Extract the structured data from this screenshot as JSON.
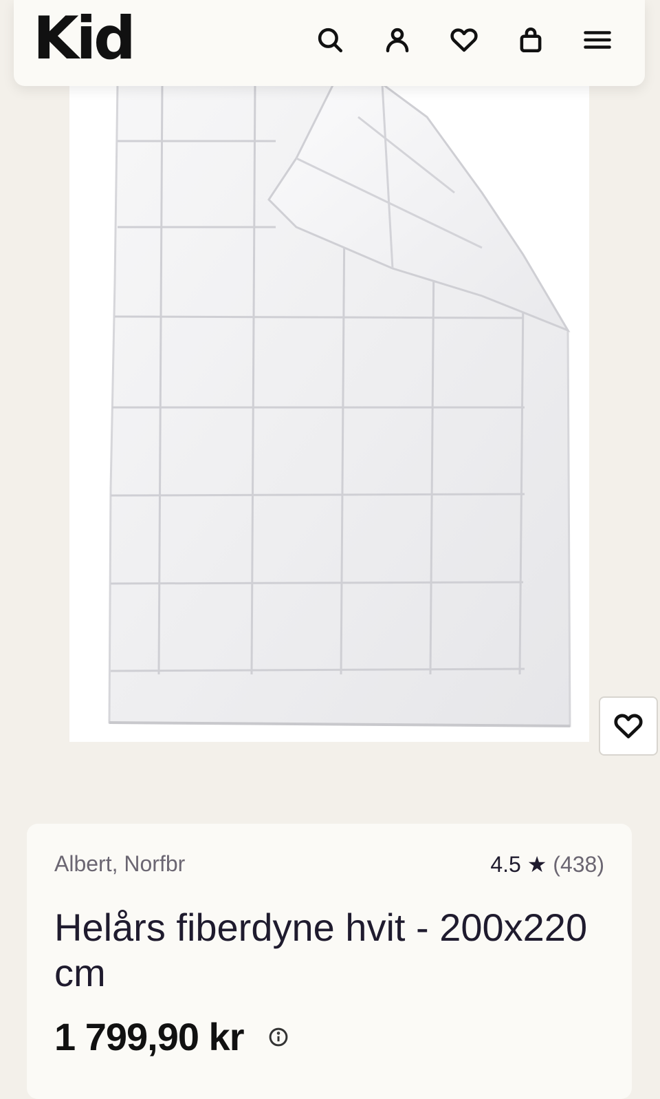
{
  "header": {
    "logo": "Kid",
    "icons": [
      "search-icon",
      "user-icon",
      "heart-icon",
      "bag-icon",
      "menu-icon"
    ]
  },
  "product": {
    "image_alt": "Helårs fiberdyne hvit",
    "brand": "Albert, Norfbr",
    "rating": "4.5",
    "rating_star": "★",
    "review_count": "(438)",
    "title": "Helårs fiberdyne hvit - 200x220 cm",
    "price": "1 799,90 kr"
  },
  "colors": {
    "page_background": "#f3f0ea",
    "card_background": "#fbfaf6",
    "text": "#1f1b2e",
    "muted_text": "#6b6672"
  }
}
